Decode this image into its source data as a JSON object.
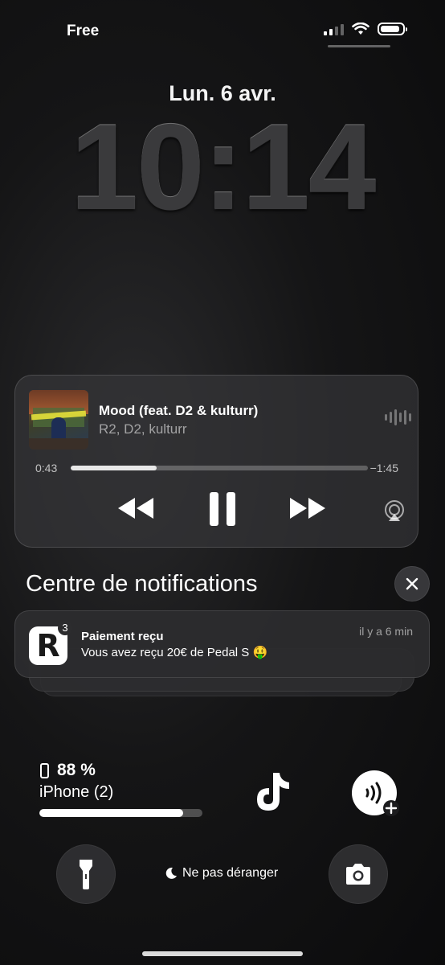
{
  "status_bar": {
    "carrier": "Free",
    "battery_level": 0.9
  },
  "lock": {
    "date": "Lun. 6 avr.",
    "time": "10:14"
  },
  "now_playing": {
    "title": "Mood (feat. D2 & kulturr)",
    "artist": "R2, D2, kulturr",
    "elapsed": "0:43",
    "remaining": "−1:45",
    "progress": 0.29,
    "icons": [
      "waveform-icon",
      "rewind-icon",
      "pause-icon",
      "forward-icon",
      "airplay-icon"
    ]
  },
  "notifications": {
    "header": "Centre de notifications",
    "items": [
      {
        "app_icon": "r3-app-icon",
        "app_glyph": "R",
        "app_superscript": "3",
        "title": "Paiement reçu",
        "body": "Vous avez reçu 20€ de Pedal  S 🤑",
        "time": "il y a 6 min"
      }
    ]
  },
  "battery_widget": {
    "percent": "88 %",
    "device": "iPhone (2)",
    "level": 0.88
  },
  "shortcuts": {
    "dnd_label": "Ne pas déranger",
    "icons": [
      "tiktok-icon",
      "shazam-icon",
      "flashlight-icon",
      "camera-icon",
      "moon-icon"
    ]
  },
  "colors": {
    "background": "#151516",
    "widget": "#343437",
    "accent": "#ffffff"
  }
}
